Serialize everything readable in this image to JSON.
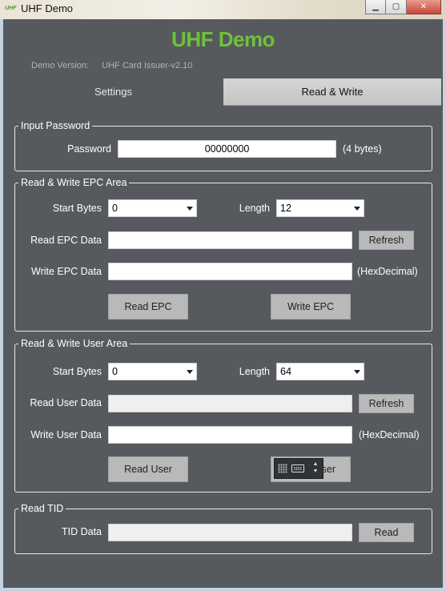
{
  "window": {
    "title": "UHF Demo",
    "icon_text": "UHF",
    "minimize_glyph": "▁",
    "maximize_glyph": "▢",
    "close_glyph": "✕"
  },
  "header": {
    "app_title": "UHF Demo",
    "version_label": "Demo Version:",
    "version_value": "UHF Card Issuer-v2.10"
  },
  "tabs": [
    {
      "label": "Settings",
      "active": false
    },
    {
      "label": "Read & Write",
      "active": true
    }
  ],
  "password_group": {
    "legend": "Input Password",
    "label": "Password",
    "value": "00000000",
    "hint": "(4 bytes)"
  },
  "epc_group": {
    "legend": "Read & Write EPC Area",
    "start_label": "Start Bytes",
    "start_value": "0",
    "length_label": "Length",
    "length_value": "12",
    "read_label": "Read EPC Data",
    "read_value": "",
    "refresh_label": "Refresh",
    "write_label": "Write EPC Data",
    "write_value": "",
    "write_hint": "(HexDecimal)",
    "read_button": "Read EPC",
    "write_button": "Write EPC"
  },
  "user_group": {
    "legend": "Read & Write User Area",
    "start_label": "Start Bytes",
    "start_value": "0",
    "length_label": "Length",
    "length_value": "64",
    "read_label": "Read User Data",
    "read_value": "",
    "refresh_label": "Refresh",
    "write_label": "Write User Data",
    "write_value": "",
    "write_hint": "(HexDecimal)",
    "read_button": "Read User",
    "write_button_partial": "ser"
  },
  "tid_group": {
    "legend": "Read TID",
    "label": "TID Data",
    "value": "",
    "read_button": "Read"
  },
  "colors": {
    "panel_bg": "#565a5f",
    "title_green": "#6fc23a",
    "button_gray": "#b9b9b9"
  },
  "ime_toolbar": {
    "arrow_up": "▲",
    "arrow_down": "▼"
  }
}
